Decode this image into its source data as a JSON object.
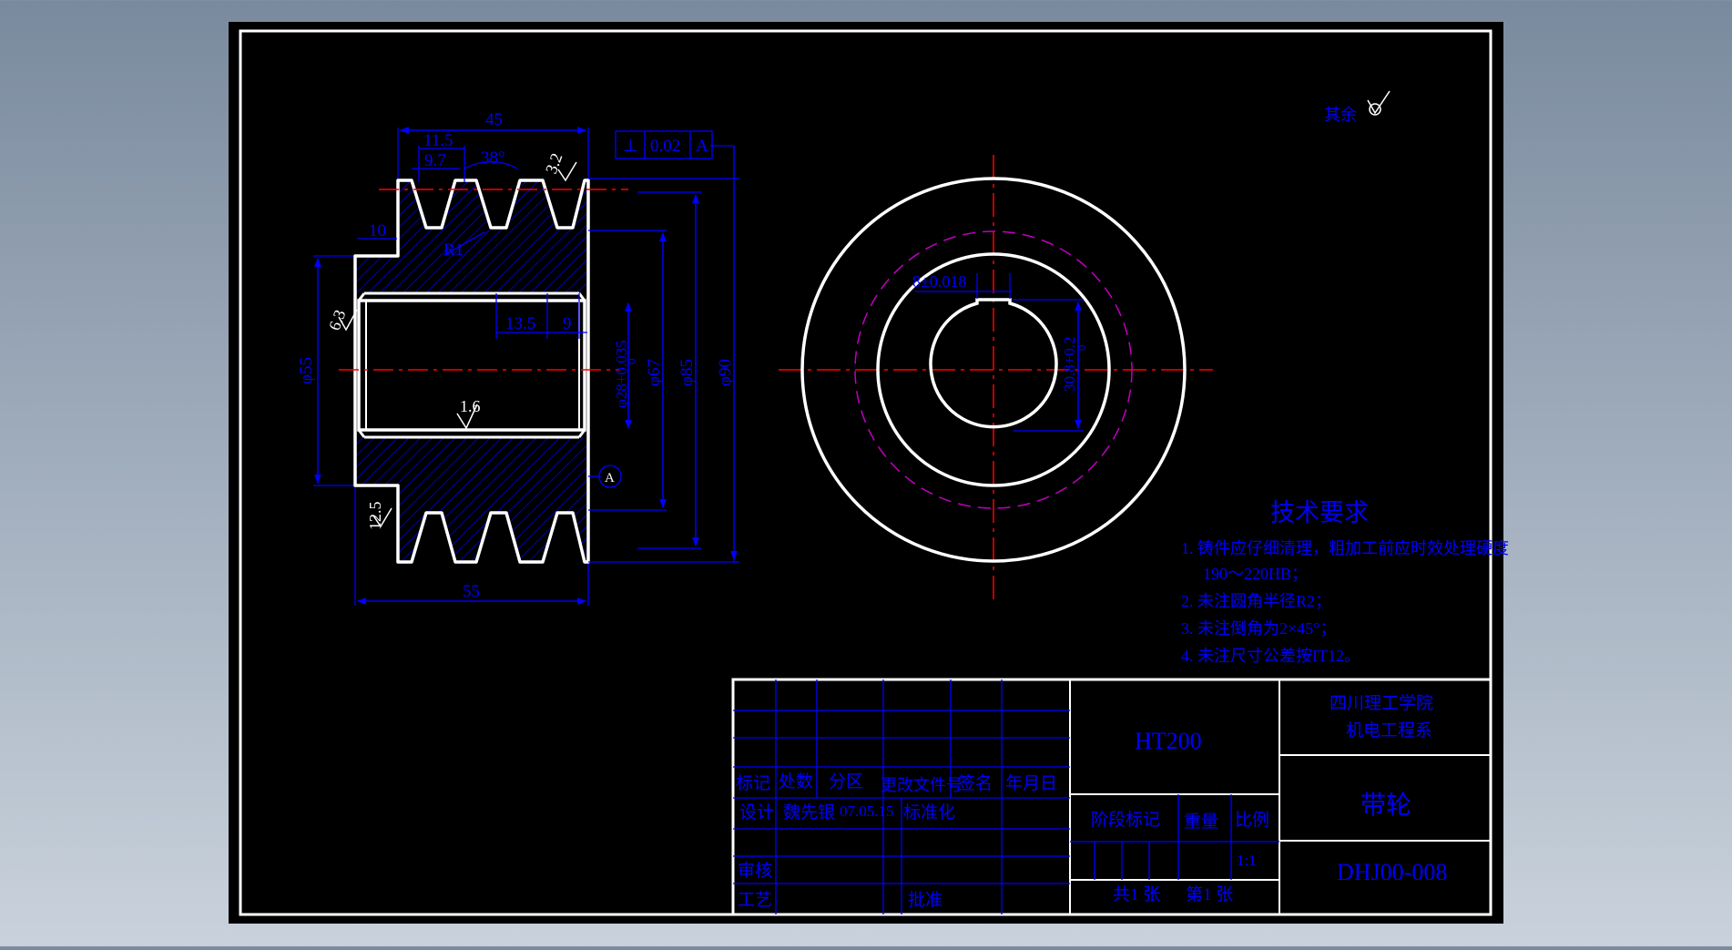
{
  "colors": {
    "background": "#000000",
    "outline": "#ffffff",
    "dimension": "#0000ff",
    "centerline": "#ff0000",
    "hidden_circle": "#c000c0"
  },
  "side_view": {
    "dims": {
      "overall_top": "45",
      "groove_pitch": "11.5",
      "groove_width": "9.7",
      "groove_angle": "38°",
      "hub_step": "10",
      "fillet": "R1",
      "bore_len_1": "13.5",
      "bore_len_2": "9",
      "overall_bottom": "55",
      "dia_55": "φ55",
      "dia_bore": "φ28+0.035",
      "dia_bore_tol_low": "0",
      "dia_67": "φ67",
      "dia_85": "φ85",
      "dia_90": "φ90"
    },
    "roughness": {
      "top": "3.2",
      "left": "6.3",
      "bore": "1.6",
      "bottom": "12.5"
    },
    "tolerance_frame": {
      "symbol": "⊥",
      "value": "0.02",
      "datum": "A"
    },
    "datum_label": "A"
  },
  "front_view": {
    "keyway_width": "8±0.018",
    "keyway_depth": "30.8+0.2",
    "keyway_depth_low": "0"
  },
  "surface_note": {
    "label": "其余"
  },
  "tech_requirements": {
    "title": "技术要求",
    "items": [
      "1. 铸件应仔细清理，粗加工前应时效处理硬度",
      "190～220HB；",
      "2. 未注圆角半径R2；",
      "3. 未注倒角为2×45°；",
      "4. 未注尺寸公差按IT12。"
    ]
  },
  "title_block": {
    "material": "HT200",
    "school_line1": "四川理工学院",
    "school_line2": "机电工程系",
    "part_name": "带轮",
    "drawing_no": "DHJ00-008",
    "headers": [
      "标记",
      "处数",
      "分区",
      "更改文件号",
      "签名",
      "年月日"
    ],
    "design_label": "设计",
    "designer": "魏先银",
    "design_date": "07.05.15",
    "standardize_label": "标准化",
    "review_label": "审核",
    "process_label": "工艺",
    "approve_label": "批准",
    "stage_mark_label": "阶段标记",
    "weight_label": "重量",
    "scale_label": "比例",
    "scale_value": "1:1",
    "sheets_total": "共1 张",
    "sheet_no": "第1 张"
  }
}
